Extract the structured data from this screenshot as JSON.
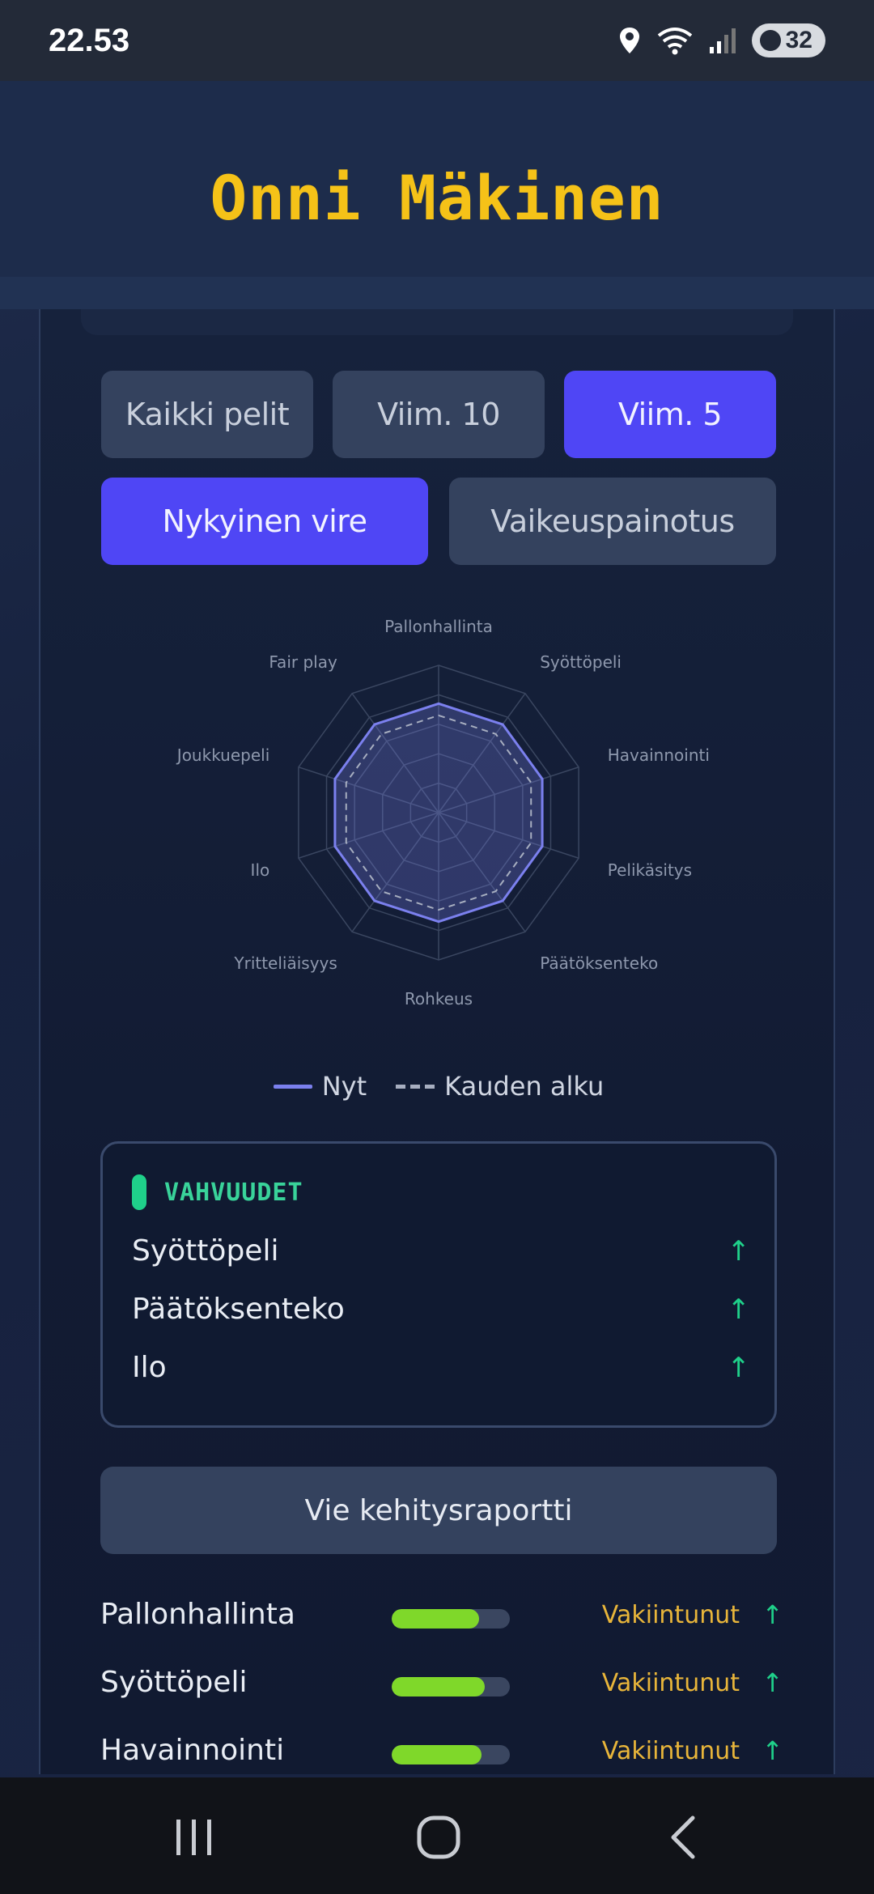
{
  "status_bar": {
    "time": "22.53",
    "battery": "32"
  },
  "header": {
    "title": "Onni Mäkinen"
  },
  "filters": {
    "range": [
      {
        "label": "Kaikki pelit",
        "active": false
      },
      {
        "label": "Viim. 10",
        "active": false
      },
      {
        "label": "Viim. 5",
        "active": true
      }
    ],
    "mode": [
      {
        "label": "Nykyinen vire",
        "active": true
      },
      {
        "label": "Vaikeuspainotus",
        "active": false
      }
    ]
  },
  "chart_data": {
    "type": "radar",
    "axes": [
      "Pallonhallinta",
      "Syöttöpeli",
      "Havainnointi",
      "Pelikäsitys",
      "Päätöksenteko",
      "Rohkeus",
      "Yritteliäisyys",
      "Ilo",
      "Joukkuepeli",
      "Fair play"
    ],
    "rmax": 5,
    "grid_levels": 5,
    "series": [
      {
        "name": "Nyt",
        "values": [
          3.7,
          3.7,
          3.7,
          3.7,
          3.7,
          3.7,
          3.7,
          3.7,
          3.7,
          3.7
        ],
        "color": "#7b80ee",
        "style": "solid"
      },
      {
        "name": "Kauden alku",
        "values": [
          3.3,
          3.3,
          3.3,
          3.3,
          3.3,
          3.3,
          3.3,
          3.3,
          3.3,
          3.3
        ],
        "color": "#a7aec0",
        "style": "dashed"
      }
    ],
    "legend_position": "bottom"
  },
  "legend": {
    "now": "Nyt",
    "season_start": "Kauden alku"
  },
  "strengths": {
    "title": "VAHVUUDET",
    "items": [
      {
        "label": "Syöttöpeli",
        "trend": "↑"
      },
      {
        "label": "Päätöksenteko",
        "trend": "↑"
      },
      {
        "label": "Ilo",
        "trend": "↑"
      }
    ]
  },
  "export_button": {
    "label": "Vie kehitysraportti"
  },
  "stats": [
    {
      "label": "Pallonhallinta",
      "level": 0.74,
      "status": "Vakiintunut",
      "trend": "↑"
    },
    {
      "label": "Syöttöpeli",
      "level": 0.79,
      "status": "Vakiintunut",
      "trend": "↑"
    },
    {
      "label": "Havainnointi",
      "level": 0.76,
      "status": "Vakiintunut",
      "trend": "↑"
    }
  ],
  "colors": {
    "accent": "#4f46f5",
    "title": "#f5c218",
    "positive": "#1fd08a",
    "warning": "#e8b53a",
    "bar_fill": "#7fd82a"
  }
}
